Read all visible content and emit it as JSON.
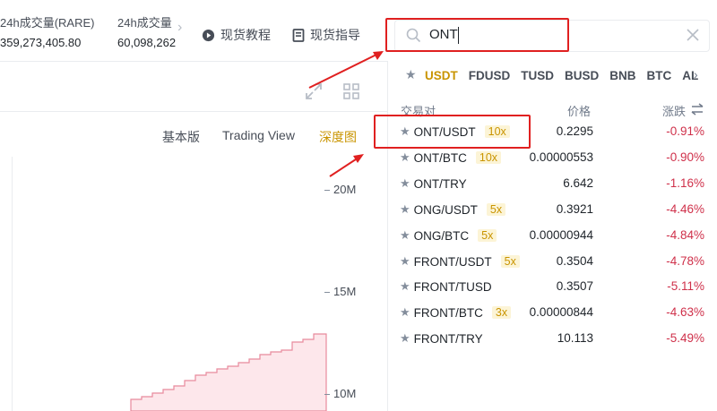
{
  "stats": [
    {
      "label": "24h成交量(RARE)",
      "value": "359,273,405.80"
    },
    {
      "label": "24h成交量",
      "value": "60,098,262"
    }
  ],
  "top_links": {
    "tutorial": "现货教程",
    "guide": "现货指导"
  },
  "view_tabs": [
    "基本版",
    "Trading View",
    "深度图"
  ],
  "active_view": "深度图",
  "y_axis": [
    "20M",
    "15M",
    "10M"
  ],
  "search": {
    "value": "ONT"
  },
  "quote_filters": [
    "USDT",
    "FDUSD",
    "TUSD",
    "BUSD",
    "BNB",
    "BTC",
    "AL"
  ],
  "active_filter": "USDT",
  "columns": {
    "pair": "交易对",
    "price": "价格",
    "change": "涨跌"
  },
  "pairs": [
    {
      "pair": "ONT/USDT",
      "leverage": "10x",
      "price": "0.2295",
      "change": "-0.91%"
    },
    {
      "pair": "ONT/BTC",
      "leverage": "10x",
      "price": "0.00000553",
      "change": "-0.90%"
    },
    {
      "pair": "ONT/TRY",
      "leverage": "",
      "price": "6.642",
      "change": "-1.16%"
    },
    {
      "pair": "ONG/USDT",
      "leverage": "5x",
      "price": "0.3921",
      "change": "-4.46%"
    },
    {
      "pair": "ONG/BTC",
      "leverage": "5x",
      "price": "0.00000944",
      "change": "-4.84%"
    },
    {
      "pair": "FRONT/USDT",
      "leverage": "5x",
      "price": "0.3504",
      "change": "-4.78%"
    },
    {
      "pair": "FRONT/TUSD",
      "leverage": "",
      "price": "0.3507",
      "change": "-5.11%"
    },
    {
      "pair": "FRONT/BTC",
      "leverage": "3x",
      "price": "0.00000844",
      "change": "-4.63%"
    },
    {
      "pair": "FRONT/TRY",
      "leverage": "",
      "price": "10.113",
      "change": "-5.49%"
    }
  ],
  "colors": {
    "accent": "#c99400",
    "down": "#cf304a",
    "annotation": "#e02020",
    "depth_fill": "#fde7eb"
  }
}
